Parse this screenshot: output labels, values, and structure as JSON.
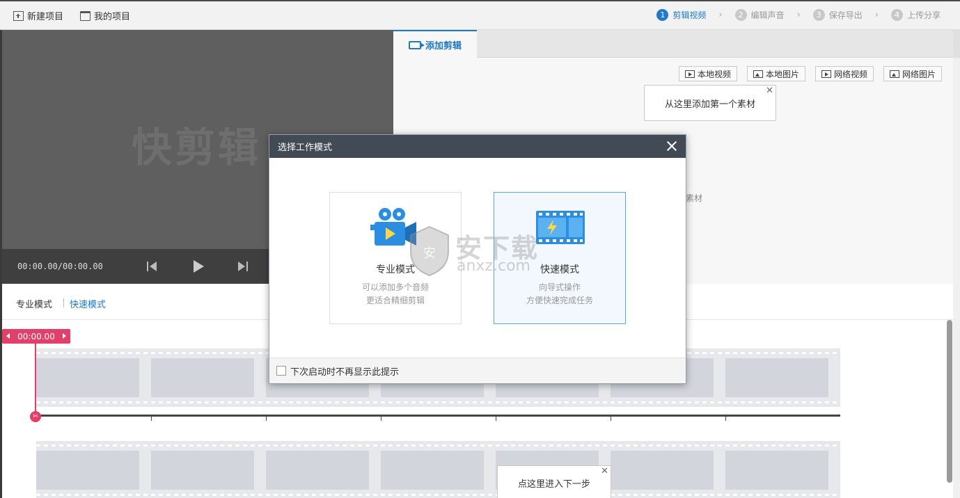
{
  "topbar": {
    "new_project": "新建项目",
    "my_projects": "我的项目",
    "steps": [
      {
        "num": "1",
        "label": "剪辑视频",
        "active": true
      },
      {
        "num": "2",
        "label": "编辑声音",
        "active": false
      },
      {
        "num": "3",
        "label": "保存导出",
        "active": false
      },
      {
        "num": "4",
        "label": "上传分享",
        "active": false
      }
    ]
  },
  "preview": {
    "logo_text": "快剪辑",
    "timecode": "00:00.00/00:00.00"
  },
  "right_panel": {
    "tab_label": "添加剪辑",
    "buttons": {
      "local_video": "本地视频",
      "local_image": "本地图片",
      "web_video": "网络视频",
      "web_image": "网络图片"
    },
    "tooltip_add": "从这里添加第一个素材",
    "hint_partial": "素材"
  },
  "mode_bar": {
    "pro_mode": "专业模式",
    "fast_mode": "快速模式"
  },
  "timeline": {
    "playhead_time": "00:00.00",
    "tooltip_next": "点这里进入下一步"
  },
  "dialog": {
    "title": "选择工作模式",
    "cards": [
      {
        "title": "专业模式",
        "line1": "可以添加多个音频",
        "line2": "更适合精细剪辑"
      },
      {
        "title": "快速模式",
        "line1": "向导式操作",
        "line2": "方便快速完成任务"
      }
    ],
    "footer_checkbox": "下次启动时不再显示此提示"
  },
  "watermark": {
    "cn": "安下载",
    "en": "anxz.com"
  },
  "colors": {
    "accent": "#1f78c8",
    "playhead": "#e23f6b",
    "dialog_header": "#414a55",
    "selected_border": "#58a8dd"
  }
}
